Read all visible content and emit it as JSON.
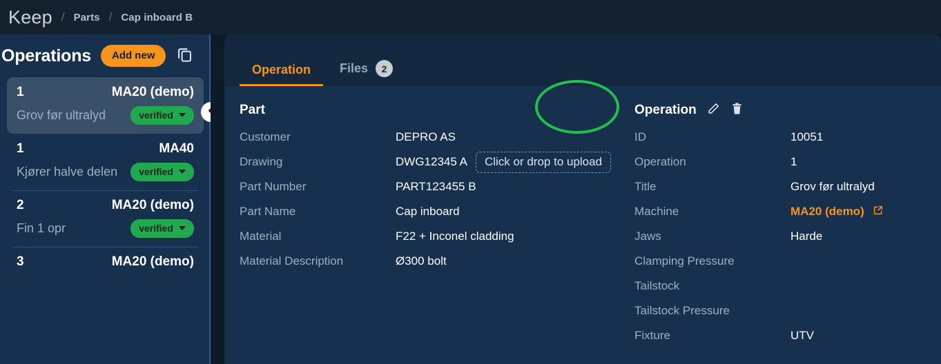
{
  "topbar": {
    "app_title": "Keep",
    "separator": "/",
    "breadcrumb": [
      "Parts",
      "Cap inboard B"
    ]
  },
  "sidebar": {
    "title": "Operations",
    "add_new_label": "Add new",
    "copy_icon": "copy-icon",
    "collapse_icon": "chevron-left-icon",
    "operations": [
      {
        "number": "1",
        "machine": "MA20 (demo)",
        "description": "Grov før ultralyd",
        "status": "verified",
        "selected": true
      },
      {
        "number": "1",
        "machine": "MA40",
        "description": "Kjører halve delen",
        "status": "verified",
        "selected": false
      },
      {
        "number": "2",
        "machine": "MA20 (demo)",
        "description": "Fin 1 opr",
        "status": "verified",
        "selected": false
      },
      {
        "number": "3",
        "machine": "MA20 (demo)",
        "description": "",
        "status": "",
        "selected": false
      }
    ]
  },
  "main": {
    "tabs": [
      {
        "label": "Operation",
        "badge": "",
        "active": true
      },
      {
        "label": "Files",
        "badge": "2",
        "active": false
      }
    ],
    "part": {
      "title": "Part",
      "fields": [
        {
          "label": "Customer",
          "value": "DEPRO AS"
        },
        {
          "label": "Drawing",
          "value": "DWG12345 A"
        },
        {
          "label": "Part Number",
          "value": "PART123455 B"
        },
        {
          "label": "Part Name",
          "value": "Cap inboard"
        },
        {
          "label": "Material",
          "value": "F22 + Inconel cladding"
        },
        {
          "label": "Material Description",
          "value": "Ø300 bolt"
        }
      ],
      "upload_label": "Click or drop to upload"
    },
    "operation": {
      "title": "Operation",
      "edit_icon": "pencil-icon",
      "delete_icon": "trash-icon",
      "fields": [
        {
          "label": "ID",
          "value": "10051"
        },
        {
          "label": "Operation",
          "value": "1"
        },
        {
          "label": "Title",
          "value": "Grov før ultralyd"
        },
        {
          "label": "Machine",
          "value": "MA20 (demo)",
          "link": true
        },
        {
          "label": "Jaws",
          "value": "Harde"
        },
        {
          "label": "Clamping Pressure",
          "value": ""
        },
        {
          "label": "Tailstock",
          "value": ""
        },
        {
          "label": "Tailstock Pressure",
          "value": ""
        },
        {
          "label": "Fixture",
          "value": "UTV"
        }
      ]
    }
  },
  "colors": {
    "accent_orange": "#f7941e",
    "status_green": "#22a94f",
    "highlight_green": "#21c04a",
    "panel_bg": "#16304d",
    "topbar_bg": "#14212f",
    "selected_item_bg": "#3a5069"
  }
}
